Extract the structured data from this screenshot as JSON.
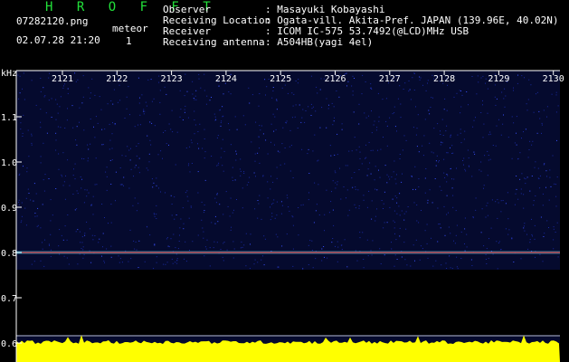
{
  "header": {
    "app_name": "H R O F F T",
    "file_name": "07282120.png",
    "datetime": "02.07.28 21:20",
    "mode_label": "meteor",
    "mode_value": "1",
    "info": [
      {
        "key": "Observer",
        "value": ": Masayuki Kobayashi"
      },
      {
        "key": "Receiving Location",
        "value": ": Ogata-vill. Akita-Pref. JAPAN (139.96E, 40.02N)"
      },
      {
        "key": "Receiver",
        "value": ": ICOM IC-575 53.7492(@LCD)MHz USB"
      },
      {
        "key": "Receiving antenna",
        "value": ": A504HB(yagi 4el)"
      }
    ]
  },
  "spectrogram": {
    "y_unit": "kHz",
    "time_labels": [
      "2121",
      "2122",
      "2123",
      "2124",
      "2125",
      "2126",
      "2127",
      "2128",
      "2129",
      "2130"
    ],
    "freq_labels": [
      "1.1",
      "1.0",
      "0.9",
      "0.8",
      "0.7",
      "0.6"
    ],
    "colors": {
      "background": "#050a2e",
      "speckle": "#1a2aa0",
      "trace": "#ff2020",
      "trace_glow": "#40e0ff",
      "axis": "#ffffff",
      "level_fill": "#ffff00"
    }
  }
}
